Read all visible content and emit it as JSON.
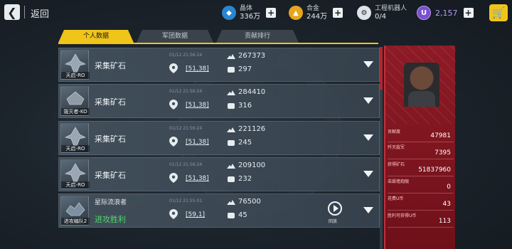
{
  "header": {
    "back_label": "返回",
    "resources": [
      {
        "icon": "crystal-icon",
        "name": "晶体",
        "value": "336万"
      },
      {
        "icon": "alloy-icon",
        "name": "合金",
        "value": "244万"
      },
      {
        "icon": "robot-icon",
        "name": "工程机器人",
        "value": "0/4"
      }
    ],
    "credits": "2,157",
    "credit_icon_label": "U"
  },
  "tabs": [
    {
      "label": "个人数据",
      "active": true
    },
    {
      "label": "军团数据",
      "active": false
    },
    {
      "label": "贡献排行",
      "active": false
    }
  ],
  "rows": [
    {
      "ship": "天启-RO",
      "mission": "采集矿石",
      "time": "01/12 21:56:24",
      "coord": "[51,38]",
      "stat1": "267373",
      "stat2": "297"
    },
    {
      "ship": "毁灭者-KO",
      "mission": "采集矿石",
      "time": "01/12 21:56:24",
      "coord": "[51,38]",
      "stat1": "284410",
      "stat2": "316"
    },
    {
      "ship": "天启-RO",
      "mission": "采集矿石",
      "time": "01/12 21:56:24",
      "coord": "[51,38]",
      "stat1": "221126",
      "stat2": "245"
    },
    {
      "ship": "天启-RO",
      "mission": "采集矿石",
      "time": "01/12 21:56:24",
      "coord": "[51,38]",
      "stat1": "209100",
      "stat2": "232"
    },
    {
      "ship": "进攻编队2",
      "mission_a": "星际流浪者",
      "mission_b": "进攻胜利",
      "time": "01/12 21:55:01",
      "coord": "[59,1]",
      "stat1": "76500",
      "stat2": "45",
      "replay": "回放"
    }
  ],
  "panel": {
    "stats": [
      {
        "label": "贡献度",
        "value": "47981"
      },
      {
        "label": "歼灭敌军",
        "value": "7395"
      },
      {
        "label": "获得矿石",
        "value": "51837960"
      },
      {
        "label": "击毁墙炮舰",
        "value": "0"
      },
      {
        "label": "花费U币",
        "value": "43"
      },
      {
        "label": "胜利可获得U币",
        "value": "113"
      }
    ]
  },
  "colors": {
    "accent": "#f0c419",
    "panel": "#8e1b26",
    "victory": "#4cd964"
  }
}
